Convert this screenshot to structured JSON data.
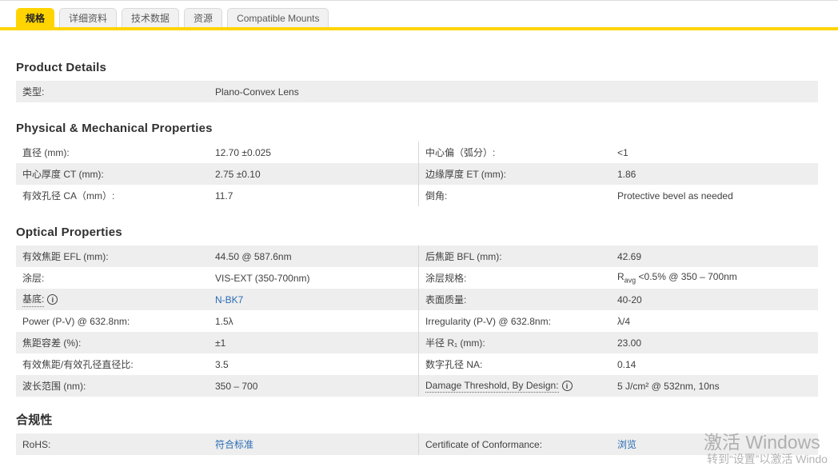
{
  "tabs": [
    {
      "label": "规格",
      "active": true
    },
    {
      "label": "详细资料",
      "active": false
    },
    {
      "label": "技术数据",
      "active": false
    },
    {
      "label": "资源",
      "active": false
    },
    {
      "label": "Compatible Mounts",
      "active": false
    }
  ],
  "icons": {
    "info_glyph": "i"
  },
  "colors": {
    "accent_yellow": "#ffd400",
    "link_blue": "#2a6cb5",
    "row_gray": "#eeeeee"
  },
  "sections": {
    "product": {
      "title": "Product Details",
      "row": {
        "label": "类型:",
        "value": "Plano-Convex Lens"
      }
    },
    "physical": {
      "title": "Physical & Mechanical Properties",
      "rows": [
        {
          "left": {
            "label": "直径 (mm):",
            "value": "12.70 ±0.025"
          },
          "right": {
            "label": "中心偏（弧分）:",
            "value": "<1"
          }
        },
        {
          "left": {
            "label": "中心厚度 CT (mm):",
            "value": "2.75 ±0.10"
          },
          "right": {
            "label": "边缘厚度 ET (mm):",
            "value": "1.86"
          }
        },
        {
          "left": {
            "label": "有效孔径 CA（mm）:",
            "value": "11.7"
          },
          "right": {
            "label": "倒角:",
            "value": "Protective bevel as needed"
          }
        }
      ]
    },
    "optical": {
      "title": "Optical Properties",
      "rows": [
        {
          "left": {
            "label": "有效焦距 EFL (mm):",
            "value": "44.50 @ 587.6nm"
          },
          "right": {
            "label": "后焦距 BFL (mm):",
            "value": "42.69"
          }
        },
        {
          "left": {
            "label": "涂层:",
            "value": "VIS-EXT (350-700nm)"
          },
          "right": {
            "label": "涂层规格:",
            "value_pre": "R",
            "value_sub": "avg",
            "value_post": " <0.5% @ 350 – 700nm"
          }
        },
        {
          "left": {
            "label": "基底:",
            "value": "N-BK7"
          },
          "right": {
            "label": "表面质量:",
            "value": "40-20"
          }
        },
        {
          "left": {
            "label": "Power (P-V) @ 632.8nm:",
            "value": "1.5λ"
          },
          "right": {
            "label": "Irregularity (P-V) @ 632.8nm:",
            "value": "λ/4"
          }
        },
        {
          "left": {
            "label": "焦距容差 (%):",
            "value": "±1"
          },
          "right": {
            "label": "半径 R₁ (mm):",
            "value": "23.00"
          }
        },
        {
          "left": {
            "label": "有效焦距/有效孔径直径比:",
            "value": "3.5"
          },
          "right": {
            "label": "数字孔径 NA:",
            "value": "0.14"
          }
        },
        {
          "left": {
            "label": "波长范围 (nm):",
            "value": "350 – 700"
          },
          "right": {
            "label": "Damage Threshold, By Design:",
            "value": "5 J/cm² @ 532nm, 10ns"
          }
        }
      ]
    },
    "compliance": {
      "title": "合规性",
      "row": {
        "left": {
          "label": "RoHS:",
          "value": "符合标准"
        },
        "right": {
          "label": "Certificate of Conformance:",
          "value": "浏览"
        }
      }
    }
  },
  "watermark": {
    "line1": "激活 Windows",
    "line2": "转到“设置”以激活 Windo"
  }
}
